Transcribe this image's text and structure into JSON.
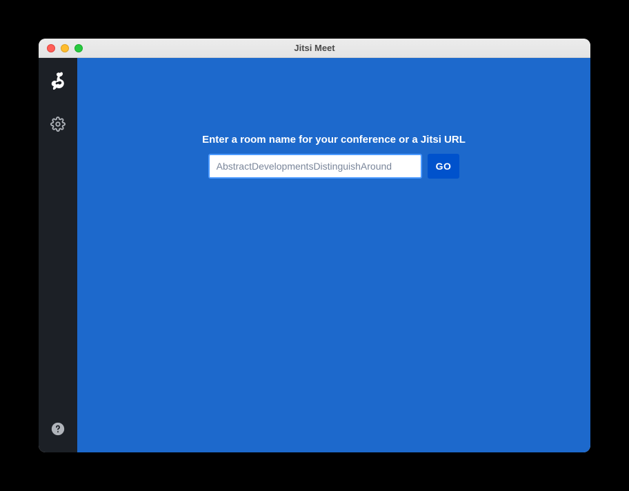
{
  "window": {
    "title": "Jitsi Meet"
  },
  "sidebar": {
    "logo_name": "jitsi-logo",
    "settings_name": "settings",
    "help_name": "help"
  },
  "main": {
    "prompt": "Enter a room name for your conference or a Jitsi URL",
    "room_placeholder": "AbstractDevelopmentsDistinguishAround",
    "room_value": "",
    "go_label": "GO"
  }
}
